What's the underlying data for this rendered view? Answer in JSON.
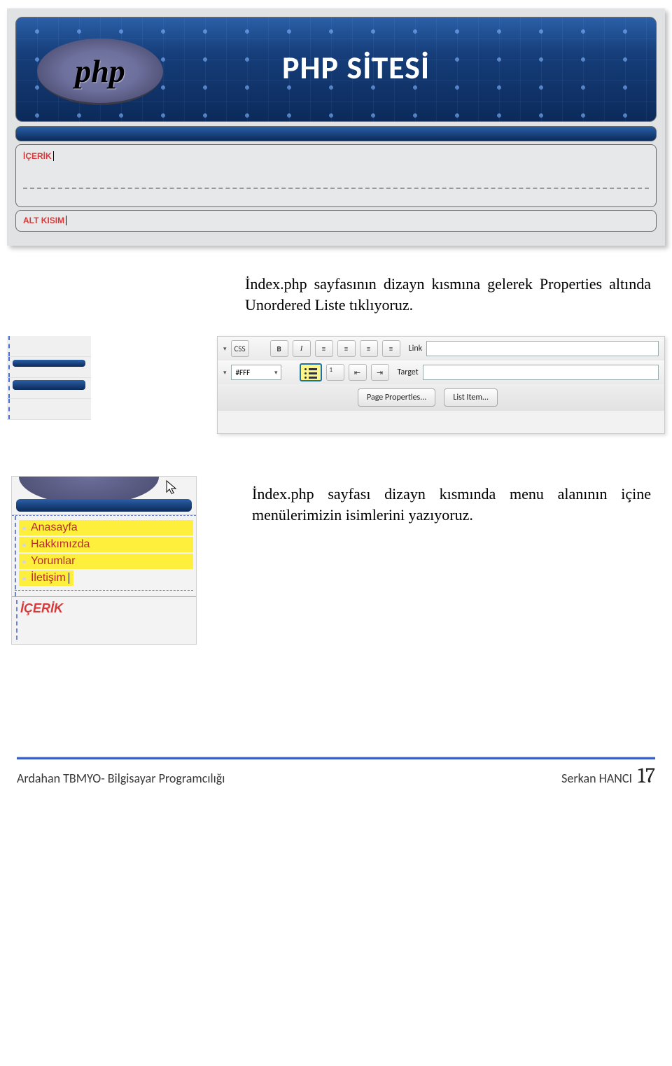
{
  "banner": {
    "logo_text": "php",
    "title": "PHP SİTESİ"
  },
  "sections": {
    "icerik": "İÇERİK",
    "alt_kisim": "ALT KISIM"
  },
  "para1": "İndex.php sayfasının dizayn kısmına gelerek Properties altında Unordered Liste tıklıyoruz.",
  "props_toolbar": {
    "css_btn": "CSS",
    "ffff": "#FFF",
    "link_label": "Link",
    "target_label": "Target",
    "btn_page_props": "Page Properties...",
    "btn_list_item": "List Item..."
  },
  "menu_items": {
    "anasayfa": "Anasayfa",
    "hakkimizda": "Hakkımızda",
    "yorumlar": "Yorumlar",
    "iletisim": "İletişim"
  },
  "para2": "İndex.php sayfası dizayn kısmında menu alanının içine menülerimizin isimlerini yazıyoruz.",
  "icerik_label": "İÇERİK",
  "footer": {
    "left": "Ardahan TBMYO- Bilgisayar Programcılığı",
    "author": "Serkan HANCI",
    "page_no": "17"
  }
}
